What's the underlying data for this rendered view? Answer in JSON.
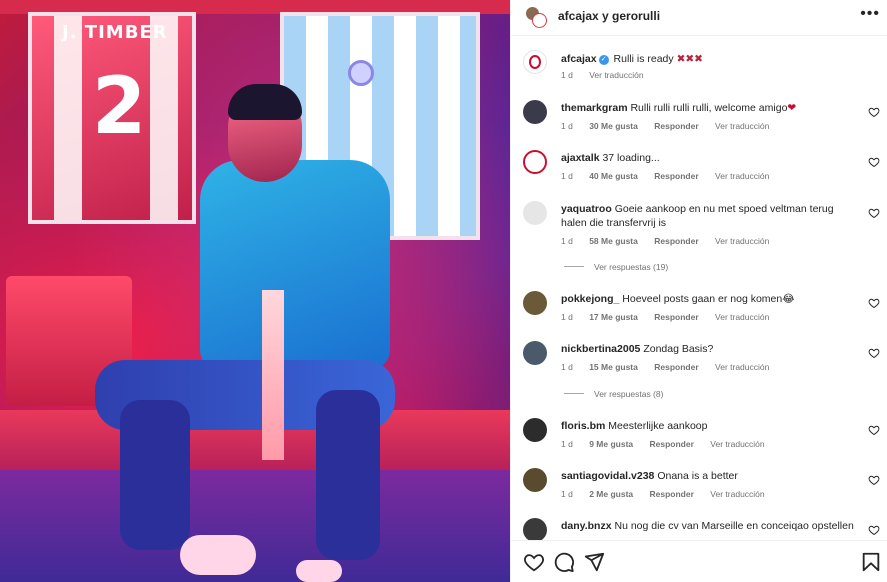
{
  "post": {
    "header_users": "afcajax y gerorulli",
    "more_icon": "more-horizontal-icon"
  },
  "caption": {
    "username": "afcajax",
    "text": "Rulli is ready",
    "emoji": "✖✖✖",
    "time": "1 d",
    "translate": "Ver traducción"
  },
  "comments": [
    {
      "username": "themarkgram",
      "text": "Rulli rulli rulli rulli, welcome amigo",
      "emoji": "❤",
      "time": "1 d",
      "likes": "30 Me gusta",
      "reply": "Responder",
      "translate": "Ver traducción"
    },
    {
      "username": "ajaxtalk",
      "text": "37 loading...",
      "emoji": "",
      "time": "1 d",
      "likes": "40 Me gusta",
      "reply": "Responder",
      "translate": "Ver traducción"
    },
    {
      "username": "yaquatroo",
      "text": "Goeie aankoop en nu met spoed veltman terug",
      "text2": "halen die transfervrij is",
      "time": "1 d",
      "likes": "58 Me gusta",
      "reply": "Responder",
      "translate": "Ver traducción",
      "view_replies": "Ver respuestas (19)"
    },
    {
      "username": "pokkejong_",
      "text": "Hoeveel posts gaan er nog komen",
      "emoji": "😂",
      "time": "1 d",
      "likes": "17 Me gusta",
      "reply": "Responder",
      "translate": "Ver traducción"
    },
    {
      "username": "nickbertina2005",
      "text": "Zondag Basis?",
      "emoji": "",
      "time": "1 d",
      "likes": "15 Me gusta",
      "reply": "Responder",
      "translate": "Ver traducción",
      "view_replies": "Ver respuestas (8)"
    },
    {
      "username": "floris.bm",
      "text": "Meesterlijke aankoop",
      "emoji": "",
      "time": "1 d",
      "likes": "9 Me gusta",
      "reply": "Responder",
      "translate": "Ver traducción"
    },
    {
      "username": "santiagovidal.v238",
      "text": "Onana is a better",
      "emoji": "",
      "time": "1 d",
      "likes": "2 Me gusta",
      "reply": "Responder",
      "translate": "Ver traducción"
    },
    {
      "username": "dany.bnzx",
      "text": "Nu nog die cv van Marseille en conceiqao opstellen",
      "emoji": ""
    }
  ],
  "photo": {
    "jersey_name": "J. TIMBER",
    "jersey_number": "2"
  },
  "action_icons": [
    "heart-icon",
    "comment-icon",
    "share-icon",
    "bookmark-icon"
  ],
  "colors": {
    "verified": "#3797f0",
    "meta_text": "#737373",
    "text": "#262626"
  }
}
